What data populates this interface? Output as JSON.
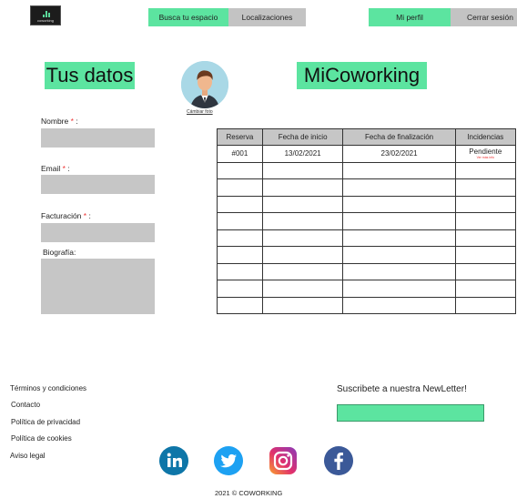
{
  "header": {
    "logo_text": "coworking",
    "nav": {
      "find_space": "Busca tu espacio",
      "locations": "Localizaciones",
      "profile": "Mi perfil",
      "logout": "Cerrar sesión"
    }
  },
  "main": {
    "title_left": "Tus datos",
    "title_right": "MiCoworking",
    "change_photo": "Cámbiar foto"
  },
  "form": {
    "name_label": "Nombre",
    "email_label": "Email",
    "billing_label": "Facturación",
    "bio_label": "Biografía:",
    "required_mark": "*",
    "colon": " :"
  },
  "table": {
    "headers": [
      "Reserva",
      "Fecha de inicio",
      "Fecha de finalización",
      "Incidencias"
    ],
    "rows": [
      {
        "reserva": "#001",
        "inicio": "13/02/2021",
        "fin": "23/02/2021",
        "incidencia": "Pendiente",
        "incidencia_sub": "Ver más info"
      }
    ],
    "empty_rows": 9
  },
  "footer": {
    "links": [
      "Términos y condiciones",
      "Contacto",
      "Política de privacidad",
      "Política de cookies",
      "Aviso legal"
    ],
    "newsletter_label": "Suscribete a nuestra NewLetter!",
    "social": [
      "linkedin-icon",
      "twitter-icon",
      "instagram-icon",
      "facebook-icon"
    ],
    "copyright": "2021 © COWORKING"
  },
  "colors": {
    "accent_green": "#5ce4a0",
    "gray_fill": "#c6c6c6",
    "required_red": "#e33333"
  }
}
